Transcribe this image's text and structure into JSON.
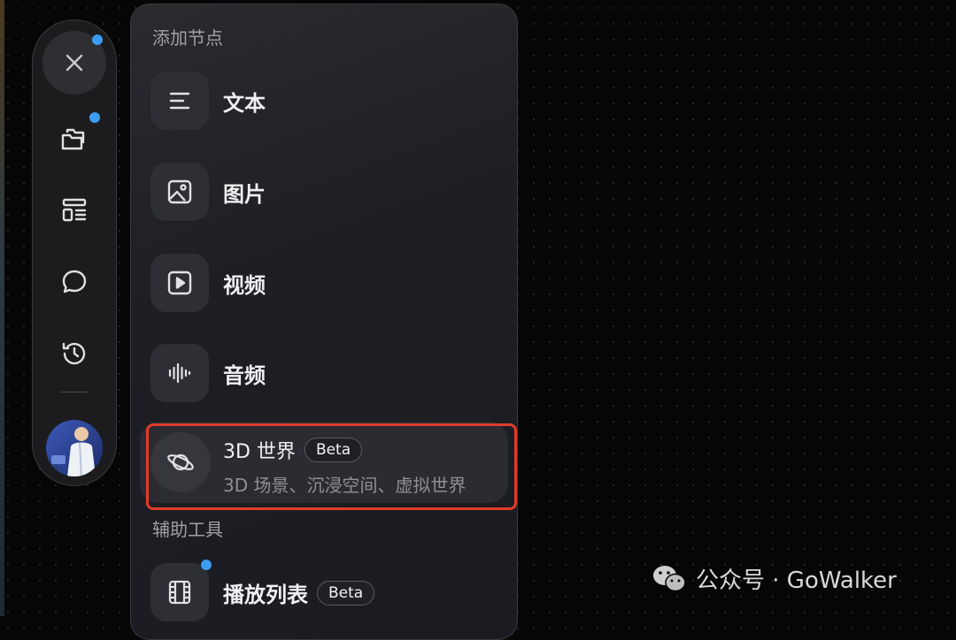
{
  "rail": {
    "items": [
      "close",
      "projects",
      "templates",
      "comments",
      "history",
      "avatar"
    ]
  },
  "panel": {
    "section_add": "添加节点",
    "items": [
      {
        "label": "文本",
        "icon": "text-lines-icon"
      },
      {
        "label": "图片",
        "icon": "image-icon"
      },
      {
        "label": "视频",
        "icon": "play-icon"
      },
      {
        "label": "音频",
        "icon": "audio-wave-icon"
      }
    ],
    "world": {
      "title": "3D 世界",
      "badge": "Beta",
      "description": "3D 场景、沉浸空间、虚拟世界",
      "icon": "planet-icon"
    },
    "section_tools": "辅助工具",
    "tools": [
      {
        "label": "播放列表",
        "badge": "Beta",
        "icon": "film-icon"
      }
    ]
  },
  "watermark": {
    "text": "公众号 · GoWalker"
  },
  "colors": {
    "accent_dot": "#3b9cf0",
    "highlight_border": "#e23a2a"
  }
}
